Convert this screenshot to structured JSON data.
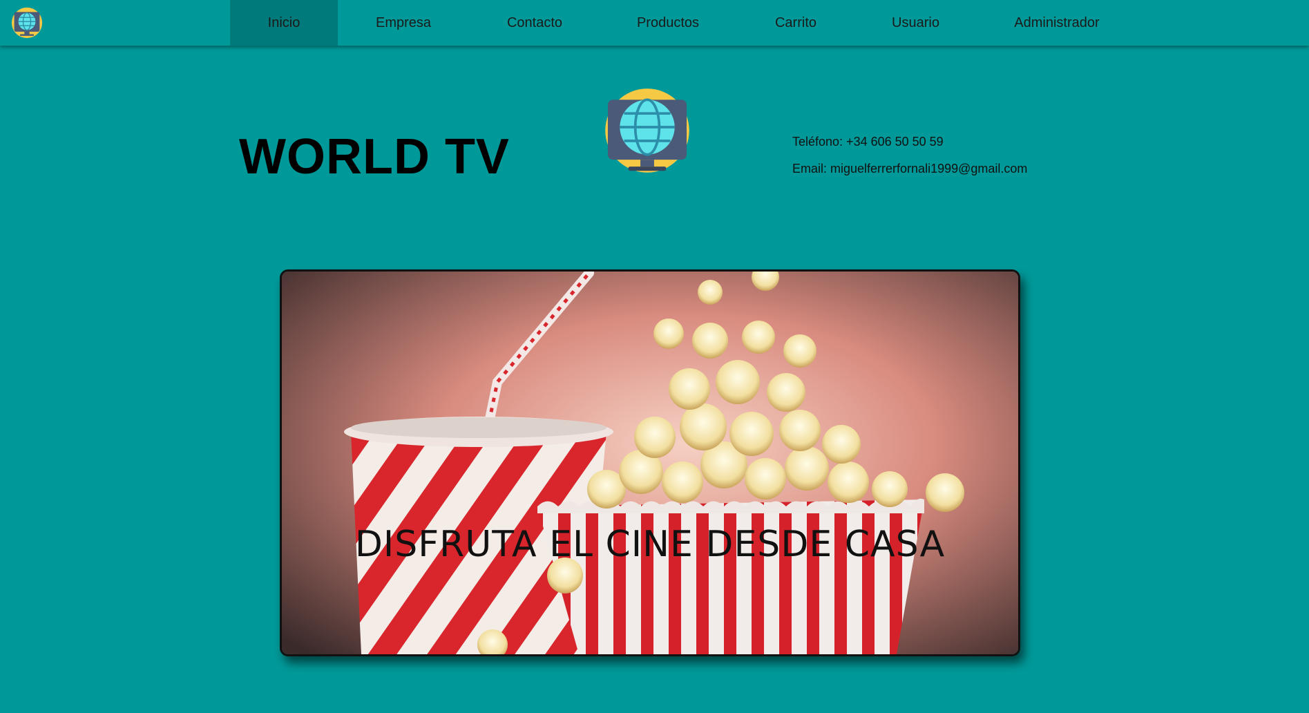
{
  "nav": {
    "logo_icon": "globe-tv-icon",
    "items": [
      {
        "label": "Inicio",
        "active": true
      },
      {
        "label": "Empresa",
        "active": false
      },
      {
        "label": "Contacto",
        "active": false
      },
      {
        "label": "Productos",
        "active": false
      },
      {
        "label": "Carrito",
        "active": false
      },
      {
        "label": "Usuario",
        "active": false
      },
      {
        "label": "Administrador",
        "active": false
      }
    ]
  },
  "header": {
    "brand": "WORLD TV",
    "logo_icon": "globe-tv-icon",
    "phone": "Teléfono: +34 606 50 50 59",
    "email": "Email: miguelferrerfornali1999@gmail.com"
  },
  "banner": {
    "caption": "DISFRUTA EL CINE DESDE CASA",
    "image": "popcorn-and-soda-illustration"
  },
  "colors": {
    "background": "#009999",
    "nav_active": "#007a7a",
    "text": "#000000"
  }
}
